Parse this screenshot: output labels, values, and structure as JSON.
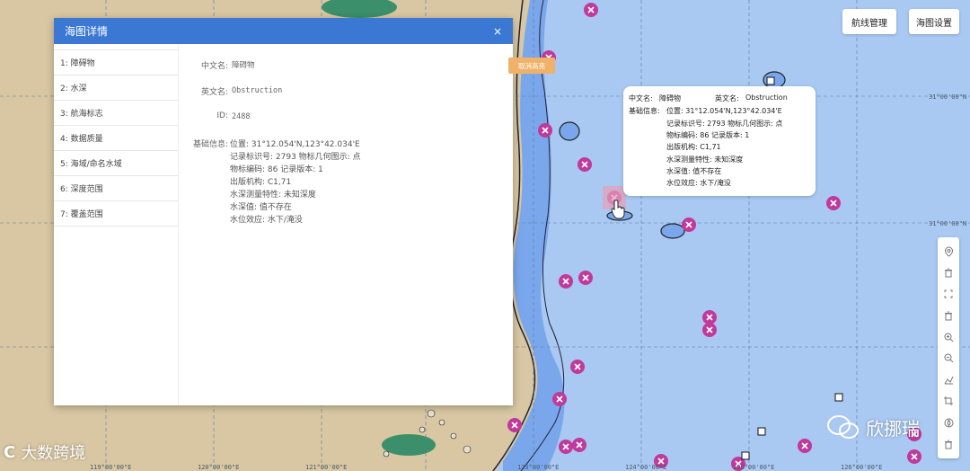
{
  "top_buttons": {
    "route_mgmt": "航线管理",
    "chart_settings": "海图设置"
  },
  "grid_labels": {
    "lat_31_00": "31°00'00\"N",
    "lat_1": "31°00'00\"N",
    "lon_1": "119°00'00\"E",
    "lon_2": "120°00'00\"E",
    "lon_3": "121°00'00\"E",
    "lon_4": "123°00'00\"E",
    "lon_5": "124°00'00\"E",
    "lon_6": "125°00'00\"E",
    "lon_7": "126°00'00\"E"
  },
  "dialog": {
    "title": "海图详情",
    "close": "×",
    "nav": [
      "1: 障碍物",
      "2: 水深",
      "3: 航海标志",
      "4: 数据质量",
      "5: 海域/命名水域",
      "6: 深度范围",
      "7: 覆盖范围"
    ],
    "cancel_highlight": "取消高亮",
    "cn_name_label": "中文名:",
    "cn_name": "障碍物",
    "en_name_label": "英文名:",
    "en_name": "Obstruction",
    "id_label": "ID:",
    "id": "2488",
    "base_label": "基础信息:",
    "info": [
      "位置:  31°12.054'N,123°42.034'E",
      "记录标识号:  2793   物标几何图示:  点",
      "物标编码:   86     记录版本:  1",
      "出版机构:   C1,71",
      "水深测量特性:  未知深度",
      "水深值:   值不存在",
      "水位效应: 水下/淹没"
    ]
  },
  "tooltip": {
    "cn_label": "中文名:",
    "cn": "障碍物",
    "en_label": "英文名:",
    "en": "Obstruction",
    "base_label": "基础信息:",
    "position": "位置:  31°12.054'N,123°42.034'E",
    "record_line": "记录标识号:  2793    物标几何图示:  点",
    "code_line": "物标编码:   86   记录版本:  1",
    "publisher": "出版机构:   C1,71",
    "depth_char": "水深测量特性:  未知深度",
    "depth_val": "水深值:   值不存在",
    "water_level": "水位效应:  水下/淹没"
  },
  "toolbar": {
    "icons": [
      "location-pin-icon",
      "trash-icon",
      "fullscreen-icon",
      "trash-icon",
      "zoom-in-icon",
      "zoom-out-icon",
      "measure-icon",
      "crop-icon",
      "compass-icon",
      "trash-icon"
    ]
  },
  "watermarks": {
    "left_text": "大数跨境",
    "right_text": "欣挪瑞"
  },
  "colors": {
    "sea": "#a9c9f2",
    "deep_sea": "#7aa7ec",
    "land": "#d8c7a2",
    "dialog_header": "#3a78d4",
    "obstruction_marker": "#c0399b",
    "cancel_button": "#f0b26a"
  }
}
